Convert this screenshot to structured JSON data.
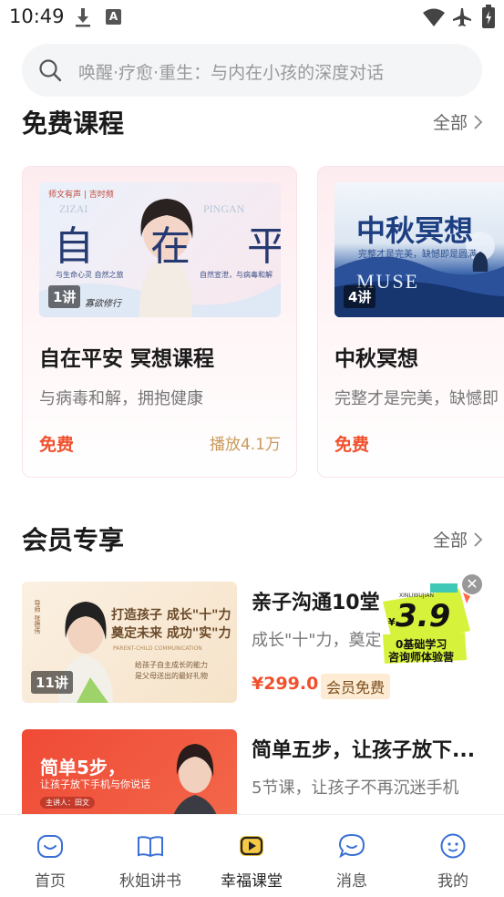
{
  "status_bar": {
    "time": "10:49"
  },
  "search": {
    "placeholder": "唤醒·疗愈·重生：与内在小孩的深度对话"
  },
  "free_section": {
    "title": "免费课程",
    "more_label": "全部",
    "cards": [
      {
        "thumb_title": "自在平安",
        "thumb_brand": "师文有声 | 吉时频",
        "thumb_sub_left": "与生命心灵 自然之旅",
        "thumb_sub_right": "自然宣泄，与病毒和解",
        "thumb_signature": "寡欲修行",
        "thumb_en_top": "ZIZAI",
        "thumb_en_right": "PINGAN",
        "lessons": "1讲",
        "title": "自在平安 冥想课程",
        "subtitle": "与病毒和解，拥抱健康",
        "price_label": "免费",
        "plays": "播放4.1万"
      },
      {
        "thumb_title": "中秋冥想",
        "thumb_sub": "完整才是完美，缺憾即是圆满",
        "thumb_en": "MUSE",
        "lessons": "4讲",
        "title": "中秋冥想",
        "subtitle": "完整才是完美，缺憾即",
        "price_label": "免费"
      }
    ]
  },
  "member_section": {
    "title": "会员专享",
    "more_label": "全部",
    "items": [
      {
        "thumb_line1": "打造孩子 成长\"十\"力",
        "thumb_line2": "奠定未来 成功\"实\"力",
        "thumb_en": "PARENT-CHILD COMMUNICATION",
        "thumb_note1": "给孩子自主成长的能力",
        "thumb_note2": "是父母送出的最好礼物",
        "thumb_teacher": "导师 张德伟",
        "lessons": "11讲",
        "title": "亲子沟通10堂",
        "subtitle": "成长\"十\"力，奠定",
        "price": "¥299.0",
        "tag": "会员免费"
      },
      {
        "thumb_line1": "简单5步，",
        "thumb_line2": "让孩子放下手机与你说话",
        "thumb_teacher": "主讲人：田文",
        "title": "简单五步，让孩子放下...",
        "subtitle": "5节课，让孩子不再沉迷手机"
      }
    ]
  },
  "promo": {
    "price": "3.9",
    "currency": "¥",
    "line1": "0基础学习",
    "line2": "咨询师体验营",
    "top_text": "XINLIWUJIAN"
  },
  "tabbar": {
    "tabs": [
      {
        "label": "首页"
      },
      {
        "label": "秋姐讲书"
      },
      {
        "label": "幸福课堂"
      },
      {
        "label": "消息"
      },
      {
        "label": "我的"
      }
    ]
  },
  "colors": {
    "accent_red": "#f0502d",
    "tag_bg": "#fdecd3",
    "card_bg": "#fdecef",
    "play_color": "#c99a5b"
  }
}
